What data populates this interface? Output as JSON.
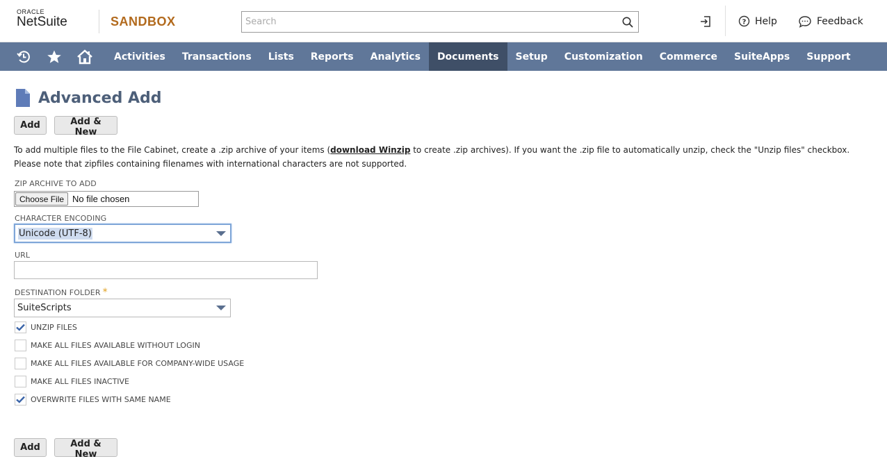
{
  "header": {
    "logo_top": "ORACLE",
    "logo_bottom": "NetSuite",
    "environment": "SANDBOX",
    "search_placeholder": "Search",
    "help_label": "Help",
    "feedback_label": "Feedback"
  },
  "nav": {
    "items": [
      {
        "label": "Activities"
      },
      {
        "label": "Transactions"
      },
      {
        "label": "Lists"
      },
      {
        "label": "Reports"
      },
      {
        "label": "Analytics"
      },
      {
        "label": "Documents",
        "active": true
      },
      {
        "label": "Setup"
      },
      {
        "label": "Customization"
      },
      {
        "label": "Commerce"
      },
      {
        "label": "SuiteApps"
      },
      {
        "label": "Support"
      }
    ]
  },
  "page": {
    "title": "Advanced Add",
    "add_label": "Add",
    "add_new_label": "Add & New",
    "info_part1": "To add multiple files to the File Cabinet, create a .zip archive of your items (",
    "info_link": "download Winzip",
    "info_part2": " to create .zip archives). If you want the .zip file to automatically unzip, check the \"Unzip files\" checkbox.",
    "info_line2": "Please note that zipfiles containing filenames with international characters are not supported."
  },
  "form": {
    "zip_label": "ZIP ARCHIVE TO ADD",
    "choose_file_label": "Choose File",
    "file_status": "No file chosen",
    "encoding_label": "CHARACTER ENCODING",
    "encoding_value": "Unicode (UTF-8)",
    "url_label": "URL",
    "url_value": "",
    "folder_label": "DESTINATION FOLDER",
    "required_mark": "*",
    "folder_value": "SuiteScripts",
    "checkboxes": [
      {
        "label": "UNZIP FILES",
        "checked": true
      },
      {
        "label": "MAKE ALL FILES AVAILABLE WITHOUT LOGIN",
        "checked": false
      },
      {
        "label": "MAKE ALL FILES AVAILABLE FOR COMPANY-WIDE USAGE",
        "checked": false
      },
      {
        "label": "MAKE ALL FILES INACTIVE",
        "checked": false
      },
      {
        "label": "OVERWRITE FILES WITH SAME NAME",
        "checked": true
      }
    ]
  },
  "colors": {
    "nav_bg": "#607799",
    "nav_active": "#3f4f67",
    "sandbox": "#b26a1d",
    "title": "#4d5f79"
  }
}
